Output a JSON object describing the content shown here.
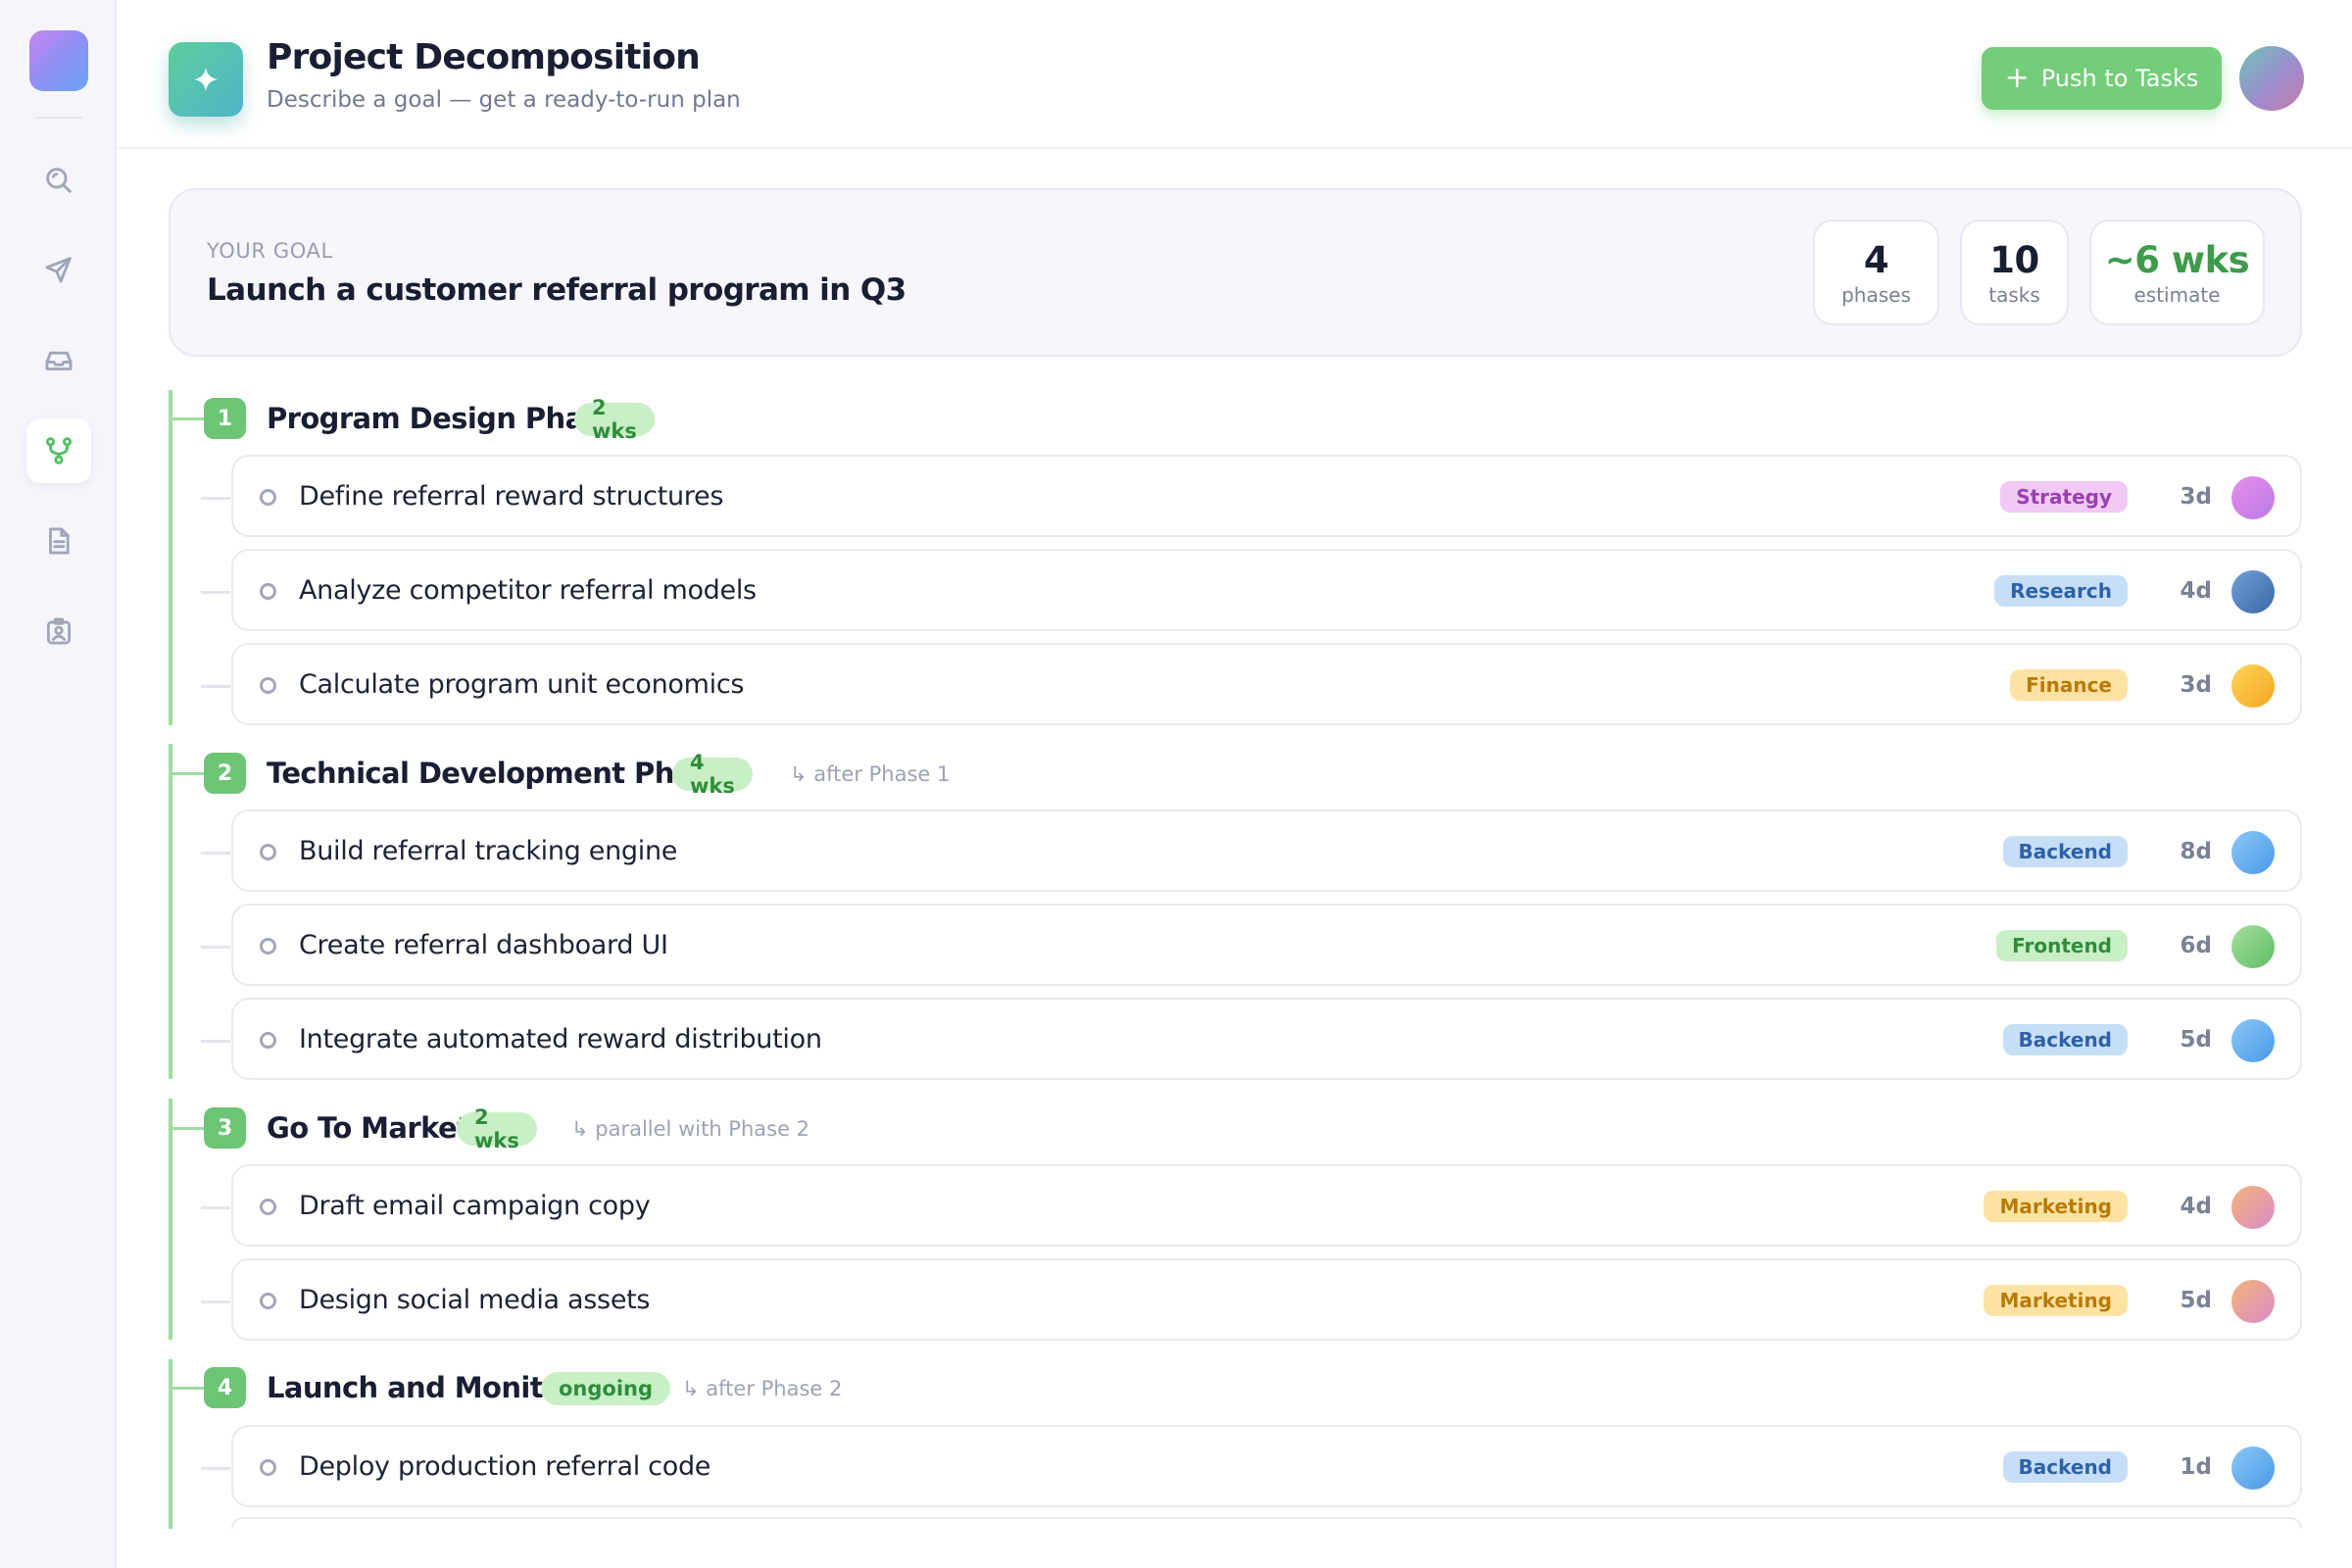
{
  "header": {
    "title": "Project Decomposition",
    "subtitle": "Describe a goal — get a ready-to-run plan",
    "push_button": "Push to Tasks"
  },
  "goal": {
    "label": "YOUR GOAL",
    "text": "Launch a customer referral program in Q3",
    "stats": [
      {
        "value": "4",
        "label": "phases"
      },
      {
        "value": "10",
        "label": "tasks"
      },
      {
        "value": "~6 wks",
        "label": "estimate"
      }
    ]
  },
  "sidebar": {
    "items": [
      {
        "icon": "search-icon"
      },
      {
        "icon": "send-icon"
      },
      {
        "icon": "inbox-icon"
      },
      {
        "icon": "git-branch-icon",
        "active": true
      },
      {
        "icon": "document-icon"
      },
      {
        "icon": "id-badge-icon"
      }
    ]
  },
  "phases": [
    {
      "number": "1",
      "title": "Program Design Phase",
      "duration": "2 wks",
      "dependency": "",
      "tasks": [
        {
          "title": "Define referral reward structures",
          "tag": "Strategy",
          "estimate": "3d"
        },
        {
          "title": "Analyze competitor referral models",
          "tag": "Research",
          "estimate": "4d"
        },
        {
          "title": "Calculate program unit economics",
          "tag": "Finance",
          "estimate": "3d"
        }
      ]
    },
    {
      "number": "2",
      "title": "Technical Development Phase",
      "duration": "4 wks",
      "dependency": "↳ after Phase 1",
      "tasks": [
        {
          "title": "Build referral tracking engine",
          "tag": "Backend",
          "estimate": "8d"
        },
        {
          "title": "Create referral dashboard UI",
          "tag": "Frontend",
          "estimate": "6d"
        },
        {
          "title": "Integrate automated reward distribution",
          "tag": "Backend",
          "estimate": "5d"
        }
      ]
    },
    {
      "number": "3",
      "title": "Go To Market",
      "duration": "2 wks",
      "dependency": "↳ parallel with Phase 2",
      "tasks": [
        {
          "title": "Draft email campaign copy",
          "tag": "Marketing",
          "estimate": "4d"
        },
        {
          "title": "Design social media assets",
          "tag": "Marketing",
          "estimate": "5d"
        }
      ]
    },
    {
      "number": "4",
      "title": "Launch and Monitor",
      "duration": "ongoing",
      "dependency": "↳ after Phase 2",
      "tasks": [
        {
          "title": "Deploy production referral code",
          "tag": "Backend",
          "estimate": "1d"
        }
      ]
    }
  ],
  "colors": {
    "accent_green": "#6cc575",
    "push_button": "#73cd79",
    "tag_strategy_bg": "#f1c9f5",
    "tag_strategy_fg": "#9a3fb0",
    "tag_research_bg": "#c7def7",
    "tag_research_fg": "#2e62a6",
    "tag_finance_bg": "#fde3a3",
    "tag_finance_fg": "#b97a07",
    "tag_backend_bg": "#c7def7",
    "tag_backend_fg": "#2e62a6",
    "tag_frontend_bg": "#c9efc6",
    "tag_frontend_fg": "#2f8d3c",
    "tag_marketing_bg": "#fde3a3",
    "tag_marketing_fg": "#b97a07"
  }
}
